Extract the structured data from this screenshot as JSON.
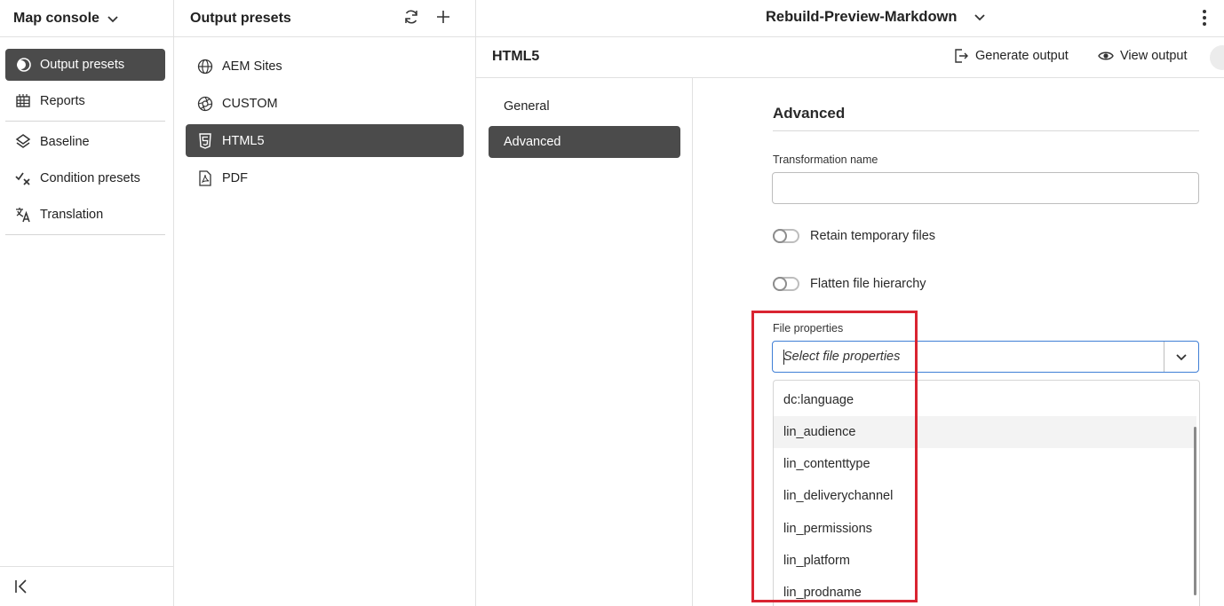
{
  "left_nav": {
    "title": "Map console",
    "items": [
      {
        "label": "Output presets",
        "icon": "output-presets-icon",
        "active": true
      },
      {
        "label": "Reports",
        "icon": "reports-icon",
        "active": false
      },
      {
        "label": "Baseline",
        "icon": "baseline-icon",
        "active": false
      },
      {
        "label": "Condition presets",
        "icon": "condition-presets-icon",
        "active": false
      },
      {
        "label": "Translation",
        "icon": "translation-icon",
        "active": false
      }
    ]
  },
  "presets_panel": {
    "title": "Output presets",
    "items": [
      {
        "label": "AEM Sites",
        "icon": "globe-icon",
        "active": false
      },
      {
        "label": "CUSTOM",
        "icon": "aperture-icon",
        "active": false
      },
      {
        "label": "HTML5",
        "icon": "html5-icon",
        "active": true
      },
      {
        "label": "PDF",
        "icon": "pdf-icon",
        "active": false
      }
    ]
  },
  "topbar": {
    "document_title": "Rebuild-Preview-Markdown"
  },
  "subbar": {
    "preset_title": "HTML5",
    "generate_label": "Generate output",
    "view_label": "View output"
  },
  "tabs": [
    {
      "label": "General",
      "active": false
    },
    {
      "label": "Advanced",
      "active": true
    }
  ],
  "form": {
    "heading": "Advanced",
    "transformation_name_label": "Transformation name",
    "transformation_name_value": "",
    "retain_temp_label": "Retain temporary files",
    "retain_temp_on": false,
    "flatten_label": "Flatten file hierarchy",
    "flatten_on": false,
    "file_properties_label": "File properties",
    "file_properties_placeholder": "Select file properties",
    "file_properties_options": [
      "dc:language",
      "lin_audience",
      "lin_contenttype",
      "lin_deliverychannel",
      "lin_permissions",
      "lin_platform",
      "lin_prodname"
    ]
  },
  "colors": {
    "active_bg": "#4b4b4b",
    "highlight": "#d92431",
    "focus_border": "#3f7fd6"
  }
}
